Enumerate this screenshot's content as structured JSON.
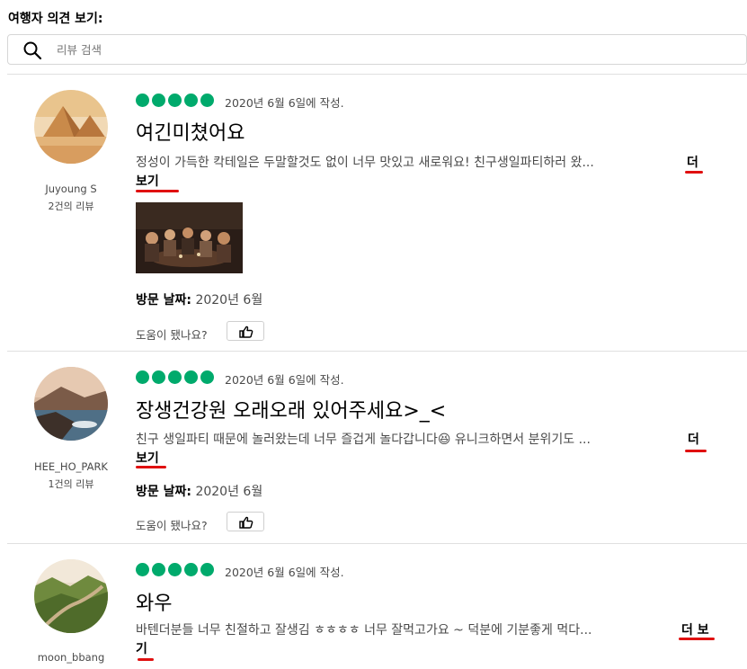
{
  "section_title": "여행자 의견 보기:",
  "search": {
    "placeholder": "리뷰 검색"
  },
  "reviews": [
    {
      "username": "Juyoung S",
      "contributions": "2건의 리뷰",
      "rating": 5,
      "date": "2020년 6월 6일에 작성.",
      "title": "여긴미쳤어요",
      "text": "정성이 가득한 칵테일은 두말할것도 없이 너무 맛있고 새로워요! 친구생일파티하러 왔...",
      "more_1": "더",
      "more_2": "보기",
      "visit_label": "방문 날짜:",
      "visit_value": "2020년 6월",
      "helpful": "도움이 됐나요?"
    },
    {
      "username": "HEE_HO_PARK",
      "contributions": "1건의 리뷰",
      "rating": 5,
      "date": "2020년 6월 6일에 작성.",
      "title": "장생건강원 오래오래 있어주세요>_<",
      "text": "친구 생일파티 때문에 놀러왔는데 너무 즐겁게 놀다갑니다😆 유니크하면서 분위기도 ...",
      "more_1": "더",
      "more_2": "보기",
      "visit_label": "방문 날짜:",
      "visit_value": "2020년 6월",
      "helpful": "도움이 됐나요?"
    },
    {
      "username": "moon_bbang",
      "rating": 5,
      "date": "2020년 6월 6일에 작성.",
      "title": "와우",
      "text": "바텐더분들 너무 친절하고 잘생김 ㅎㅎㅎㅎ 너무 잘먹고가요 ~ 덕분에 기분좋게 먹다...",
      "more_1": "더 보",
      "more_2": "기"
    }
  ],
  "colors": {
    "rating_bubble": "#00aa6c",
    "annotation_mark": "#e01010"
  }
}
